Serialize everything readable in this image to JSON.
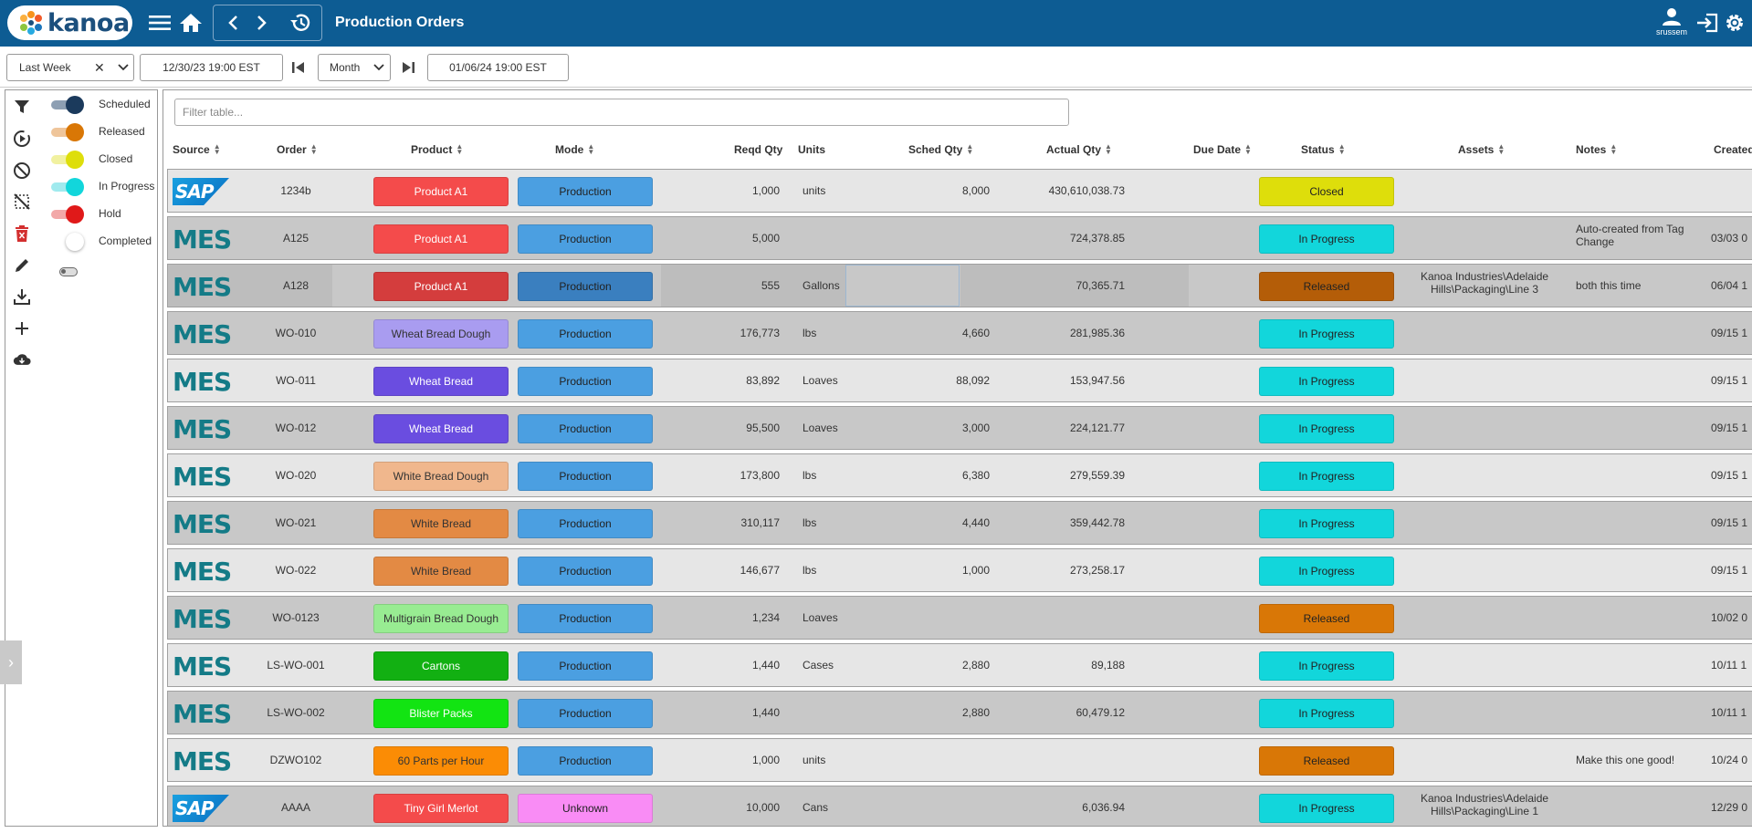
{
  "app": {
    "brand": "kanoa",
    "title": "Production Orders"
  },
  "user": {
    "name": "srussem"
  },
  "filters": {
    "range": "Last Week",
    "start": "12/30/23 19:00 EST",
    "period": "Month",
    "end": "01/06/24 19:00 EST"
  },
  "legend": [
    {
      "label": "Scheduled",
      "color": "#1b3a5c"
    },
    {
      "label": "Released",
      "color": "#d97706"
    },
    {
      "label": "Closed",
      "color": "#dede0b"
    },
    {
      "label": "In Progress",
      "color": "#12d6db"
    },
    {
      "label": "Hold",
      "color": "#e01919"
    },
    {
      "label": "Completed",
      "color": "#ffffff"
    }
  ],
  "table": {
    "filter_placeholder": "Filter table...",
    "headers": {
      "source": "Source",
      "order": "Order",
      "product": "Product",
      "mode": "Mode",
      "reqd": "Reqd Qty",
      "units": "Units",
      "sched": "Sched Qty",
      "actual": "Actual Qty",
      "due": "Due Date",
      "status": "Status",
      "assets": "Assets",
      "notes": "Notes",
      "created": "Created"
    },
    "rows": [
      {
        "source": "SAP",
        "order": "1234b",
        "product": "Product A1",
        "product_color": "#f44b4b",
        "product_text": "#fff",
        "mode": "Production",
        "mode_color": "#4b9fe1",
        "reqd": "1,000",
        "units": "units",
        "sched": "8,000",
        "actual": "430,610,038.73",
        "status": "Closed",
        "status_color": "#dede0b",
        "assets": "",
        "notes": "",
        "created": "",
        "shade": "light"
      },
      {
        "source": "MES",
        "order": "A125",
        "product": "Product A1",
        "product_color": "#f44b4b",
        "product_text": "#fff",
        "mode": "Production",
        "mode_color": "#4b9fe1",
        "reqd": "5,000",
        "units": "",
        "sched": "",
        "actual": "724,378.85",
        "status": "In Progress",
        "status_color": "#12d6db",
        "assets": "",
        "notes": "Auto-created from Tag Change",
        "created": "03/03 0",
        "shade": "dark"
      },
      {
        "source": "MES",
        "order": "A128",
        "product": "Product A1",
        "product_color": "#d43d3d",
        "product_text": "#fff",
        "mode": "Production",
        "mode_color": "#3a7fbf",
        "reqd": "555",
        "units": "Gallons",
        "sched": "",
        "actual": "70,365.71",
        "status": "Released",
        "status_color": "#b45d08",
        "assets": "Kanoa Industries\\Adelaide Hills\\Packaging\\Line 3",
        "notes": "both this time",
        "created": "06/04 1",
        "shade": "sel"
      },
      {
        "source": "MES",
        "order": "WO-010",
        "product": "Wheat Bread Dough",
        "product_color": "#a99cf0",
        "product_text": "#333",
        "mode": "Production",
        "mode_color": "#4b9fe1",
        "reqd": "176,773",
        "units": "lbs",
        "sched": "4,660",
        "actual": "281,985.36",
        "status": "In Progress",
        "status_color": "#12d6db",
        "assets": "",
        "notes": "",
        "created": "09/15 1",
        "shade": "dark"
      },
      {
        "source": "MES",
        "order": "WO-011",
        "product": "Wheat Bread",
        "product_color": "#6a4de0",
        "product_text": "#fff",
        "mode": "Production",
        "mode_color": "#4b9fe1",
        "reqd": "83,892",
        "units": "Loaves",
        "sched": "88,092",
        "actual": "153,947.56",
        "status": "In Progress",
        "status_color": "#12d6db",
        "assets": "",
        "notes": "",
        "created": "09/15 1",
        "shade": "light"
      },
      {
        "source": "MES",
        "order": "WO-012",
        "product": "Wheat Bread",
        "product_color": "#6a4de0",
        "product_text": "#fff",
        "mode": "Production",
        "mode_color": "#4b9fe1",
        "reqd": "95,500",
        "units": "Loaves",
        "sched": "3,000",
        "actual": "224,121.77",
        "status": "In Progress",
        "status_color": "#12d6db",
        "assets": "",
        "notes": "",
        "created": "09/15 1",
        "shade": "dark"
      },
      {
        "source": "MES",
        "order": "WO-020",
        "product": "White Bread Dough",
        "product_color": "#f0b78d",
        "product_text": "#333",
        "mode": "Production",
        "mode_color": "#4b9fe1",
        "reqd": "173,800",
        "units": "lbs",
        "sched": "6,380",
        "actual": "279,559.39",
        "status": "In Progress",
        "status_color": "#12d6db",
        "assets": "",
        "notes": "",
        "created": "09/15 1",
        "shade": "light"
      },
      {
        "source": "MES",
        "order": "WO-021",
        "product": "White Bread",
        "product_color": "#e38a44",
        "product_text": "#333",
        "mode": "Production",
        "mode_color": "#4b9fe1",
        "reqd": "310,117",
        "units": "lbs",
        "sched": "4,440",
        "actual": "359,442.78",
        "status": "In Progress",
        "status_color": "#12d6db",
        "assets": "",
        "notes": "",
        "created": "09/15 1",
        "shade": "dark"
      },
      {
        "source": "MES",
        "order": "WO-022",
        "product": "White Bread",
        "product_color": "#e38a44",
        "product_text": "#333",
        "mode": "Production",
        "mode_color": "#4b9fe1",
        "reqd": "146,677",
        "units": "lbs",
        "sched": "1,000",
        "actual": "273,258.17",
        "status": "In Progress",
        "status_color": "#12d6db",
        "assets": "",
        "notes": "",
        "created": "09/15 1",
        "shade": "light"
      },
      {
        "source": "MES",
        "order": "WO-0123",
        "product": "Multigrain Bread Dough",
        "product_color": "#98ec92",
        "product_text": "#333",
        "mode": "Production",
        "mode_color": "#4b9fe1",
        "reqd": "1,234",
        "units": "Loaves",
        "sched": "",
        "actual": "",
        "status": "Released",
        "status_color": "#d97706",
        "assets": "",
        "notes": "",
        "created": "10/02 0",
        "shade": "dark"
      },
      {
        "source": "MES",
        "order": "LS-WO-001",
        "product": "Cartons",
        "product_color": "#12b012",
        "product_text": "#fff",
        "mode": "Production",
        "mode_color": "#4b9fe1",
        "reqd": "1,440",
        "units": "Cases",
        "sched": "2,880",
        "actual": "89,188",
        "status": "In Progress",
        "status_color": "#12d6db",
        "assets": "",
        "notes": "",
        "created": "10/11 1",
        "shade": "light"
      },
      {
        "source": "MES",
        "order": "LS-WO-002",
        "product": "Blister Packs",
        "product_color": "#12e412",
        "product_text": "#fff",
        "mode": "Production",
        "mode_color": "#4b9fe1",
        "reqd": "1,440",
        "units": "",
        "sched": "2,880",
        "actual": "60,479.12",
        "status": "In Progress",
        "status_color": "#12d6db",
        "assets": "",
        "notes": "",
        "created": "10/11 1",
        "shade": "dark"
      },
      {
        "source": "MES",
        "order": "DZWO102",
        "product": "60 Parts per Hour",
        "product_color": "#fb8c05",
        "product_text": "#333",
        "mode": "Production",
        "mode_color": "#4b9fe1",
        "reqd": "1,000",
        "units": "units",
        "sched": "",
        "actual": "",
        "status": "Released",
        "status_color": "#d97706",
        "assets": "",
        "notes": "Make this one good!",
        "created": "10/24 0",
        "shade": "light"
      },
      {
        "source": "SAP",
        "order": "AAAA",
        "product": "Tiny Girl Merlot",
        "product_color": "#f44b4b",
        "product_text": "#fff",
        "mode": "Unknown",
        "mode_color": "#f98cf5",
        "reqd": "10,000",
        "units": "Cans",
        "sched": "",
        "actual": "6,036.94",
        "status": "In Progress",
        "status_color": "#12d6db",
        "assets": "Kanoa Industries\\Adelaide Hills\\Packaging\\Line 1",
        "notes": "",
        "created": "12/29 0",
        "shade": "dark"
      }
    ]
  }
}
